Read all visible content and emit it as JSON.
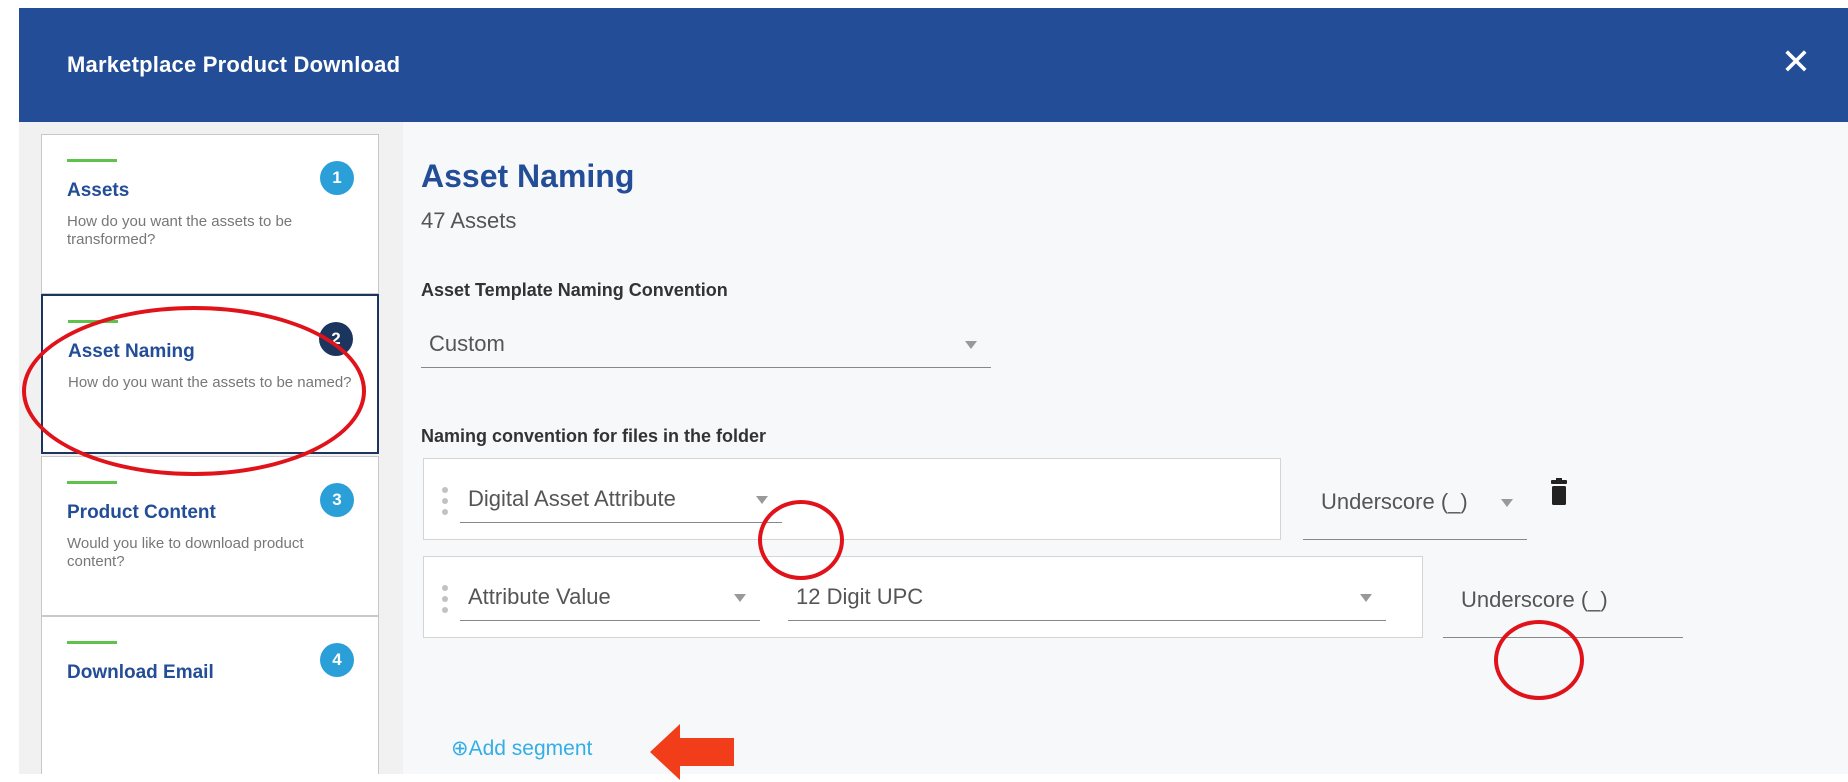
{
  "modal": {
    "title": "Marketplace Product Download",
    "close_icon": "close-icon",
    "header_color": "#234e97"
  },
  "steps": [
    {
      "number": "1",
      "title": "Assets",
      "description": "How do you want the assets to be transformed?"
    },
    {
      "number": "2",
      "title": "Asset Naming",
      "description": "How do you want the assets to be named?",
      "active": true
    },
    {
      "number": "3",
      "title": "Product Content",
      "description": "Would you like to download product content?"
    },
    {
      "number": "4",
      "title": "Download Email",
      "description": ""
    }
  ],
  "content": {
    "title": "Asset Naming",
    "asset_count": "47 Assets",
    "template_label": "Asset Template Naming Convention",
    "template_value": "Custom",
    "folder_label": "Naming convention for files in the folder",
    "segments": [
      {
        "attribute_type": "Digital Asset Attribute",
        "separator": "Underscore (_)"
      },
      {
        "attribute_type": "Attribute Value",
        "attribute": "12 Digit UPC",
        "separator": "Underscore (_)"
      }
    ],
    "add_segment": "⊕Add segment"
  },
  "colors": {
    "accent": "#234e97",
    "step_badge": "#2a9fd8",
    "active_badge": "#1c355e",
    "progress_bar": "#5ec24c",
    "link": "#34aee6",
    "annotation": "#e0121a"
  }
}
